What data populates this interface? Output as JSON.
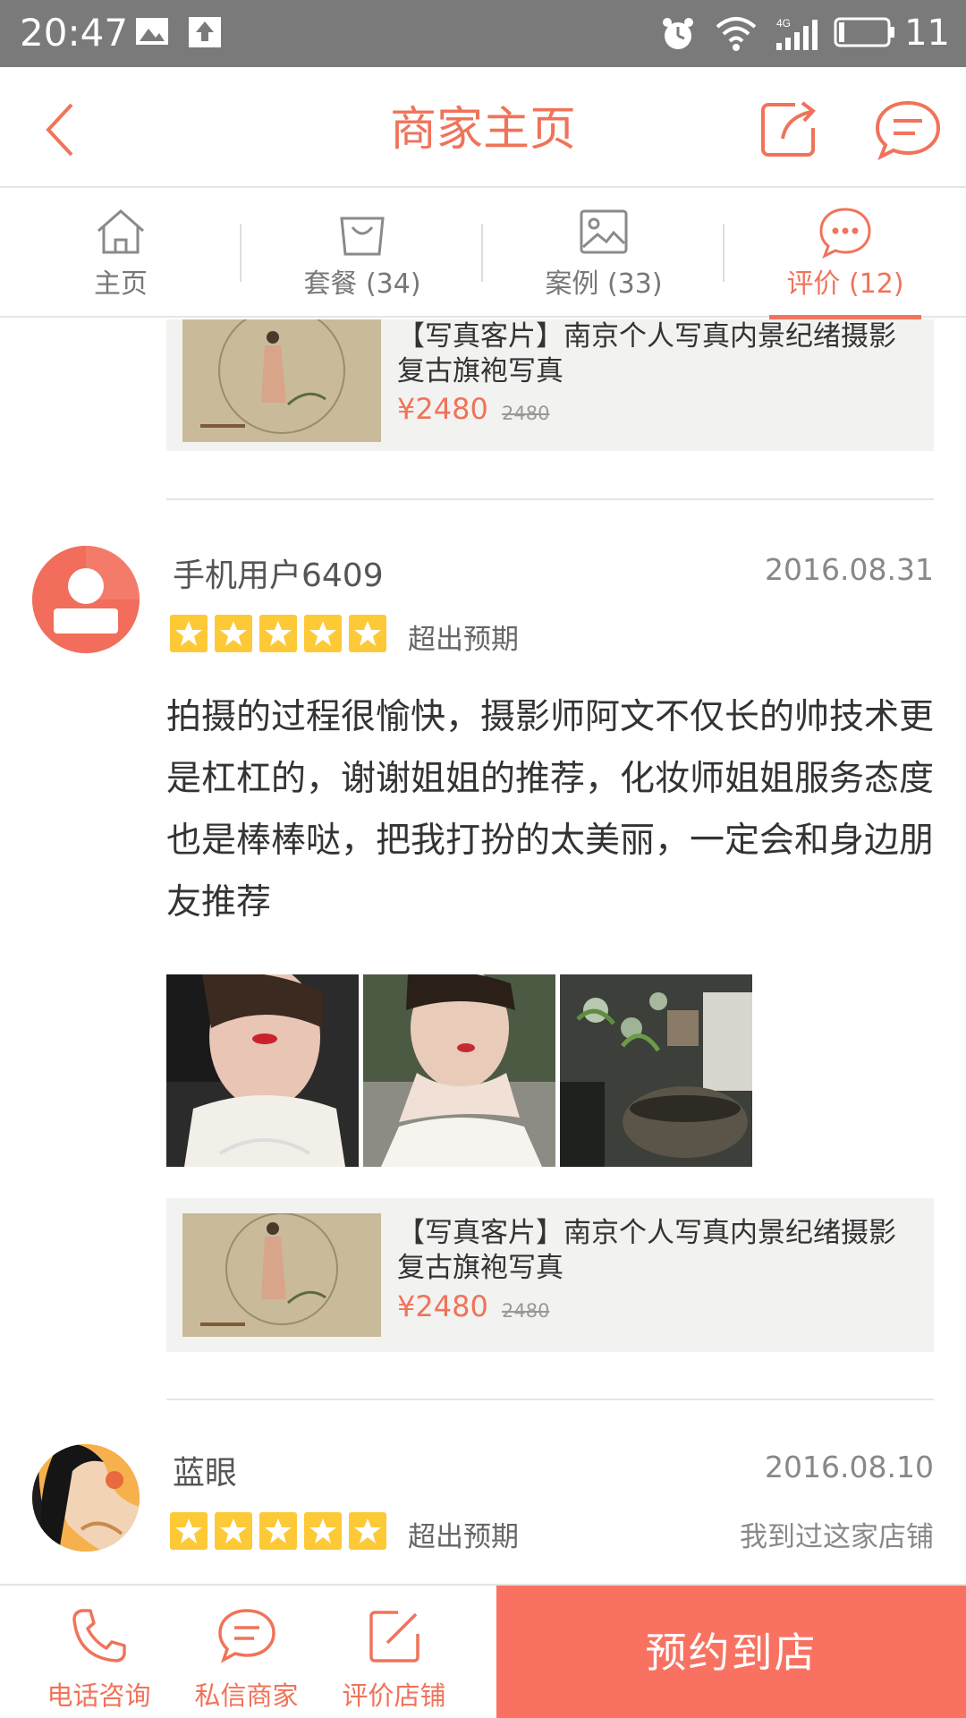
{
  "status_bar": {
    "time": "20:47",
    "battery": "11"
  },
  "header": {
    "title": "商家主页"
  },
  "tabs": [
    {
      "label": "主页",
      "icon": "home-icon"
    },
    {
      "label": "套餐 (34)",
      "icon": "bag-icon"
    },
    {
      "label": "案例 (33)",
      "icon": "image-icon"
    },
    {
      "label": "评价 (12)",
      "icon": "comment-icon",
      "active": true
    }
  ],
  "packages": [
    {
      "name": "【写真客片】南京个人写真内景纪绪摄影复古旗袍写真",
      "price": "¥2480",
      "original_price": "2480"
    },
    {
      "name": "【写真客片】南京个人写真内景纪绪摄影复古旗袍写真",
      "price": "¥2480",
      "original_price": "2480"
    }
  ],
  "reviews": [
    {
      "user": "手机用户6409",
      "date": "2016.08.31",
      "rating": 5,
      "tag": "超出预期",
      "text": "拍摄的过程很愉快，摄影师阿文不仅长的帅技术更是杠杠的，谢谢姐姐的推荐，化妆师姐姐服务态度也是棒棒哒，把我打扮的太美丽，一定会和身边朋友推荐",
      "photo_count": 3
    },
    {
      "user": "蓝眼",
      "date": "2016.08.10",
      "rating": 5,
      "tag": "超出预期",
      "visited": "我到过这家店铺"
    }
  ],
  "bottom_bar": {
    "call_label": "电话咨询",
    "message_label": "私信商家",
    "review_label": "评价店铺",
    "book_label": "预约到店"
  },
  "colors": {
    "accent": "#f0735a",
    "book_button": "#f97261",
    "star": "#fdc936",
    "status_bar": "#7a7a7a"
  }
}
